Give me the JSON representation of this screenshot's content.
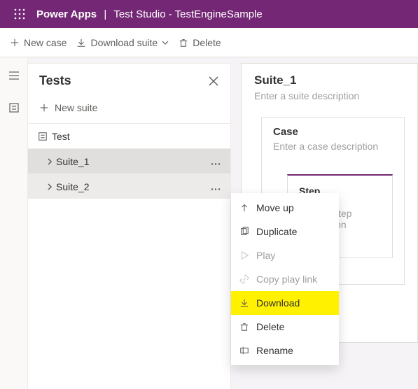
{
  "header": {
    "brand": "Power Apps",
    "section": "Test Studio - TestEngineSample"
  },
  "commandBar": {
    "newCase": "New case",
    "downloadSuite": "Download suite",
    "delete": "Delete"
  },
  "testsPanel": {
    "title": "Tests",
    "newSuite": "New suite",
    "rootNode": "Test",
    "suite1": "Suite_1",
    "suite2": "Suite_2"
  },
  "main": {
    "suiteTitle": "Suite_1",
    "suitePlaceholder": "Enter a suite description",
    "caseTitle": "Case",
    "casePlaceholder": "Enter a case description",
    "stepTitle": "Step",
    "stepPlaceholder": "Enter a step description"
  },
  "contextMenu": {
    "moveUp": "Move up",
    "duplicate": "Duplicate",
    "play": "Play",
    "copyPlayLink": "Copy play link",
    "download": "Download",
    "delete": "Delete",
    "rename": "Rename"
  }
}
